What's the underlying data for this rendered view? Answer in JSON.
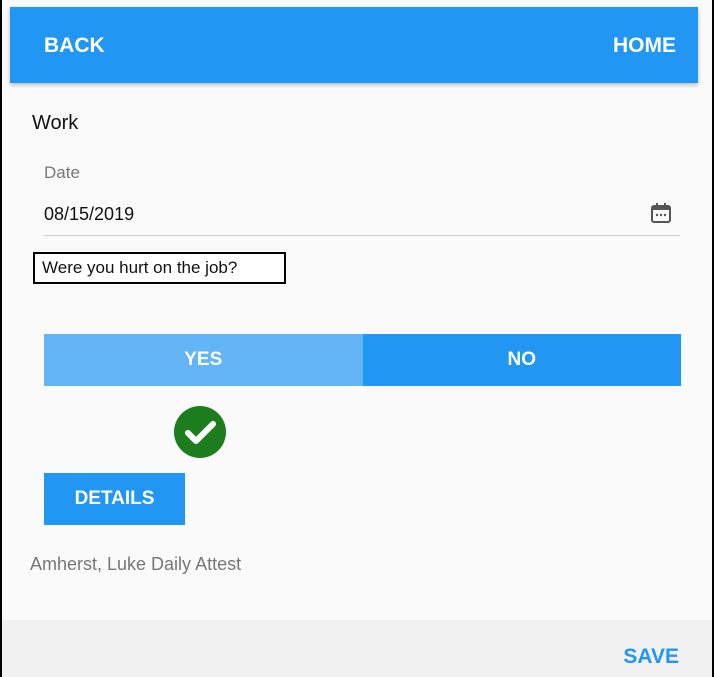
{
  "header": {
    "back_label": "BACK",
    "home_label": "HOME",
    "color": "#2196f3"
  },
  "form": {
    "section_title": "Work",
    "date_label": "Date",
    "date_value": "08/15/2019",
    "date_icon": "calendar-icon",
    "question": "Were you hurt on the job?",
    "options": {
      "yes_label": "YES",
      "no_label": "NO",
      "selected": "YES"
    },
    "selected_indicator_icon": "check-circle-icon",
    "details_label": "DETAILS"
  },
  "footer": {
    "attest_text": "Amherst, Luke Daily Attest",
    "save_label": "SAVE"
  },
  "colors": {
    "primary": "#2196f3",
    "selected_light": "#64b5f6",
    "check_green": "#1b7d1b"
  }
}
